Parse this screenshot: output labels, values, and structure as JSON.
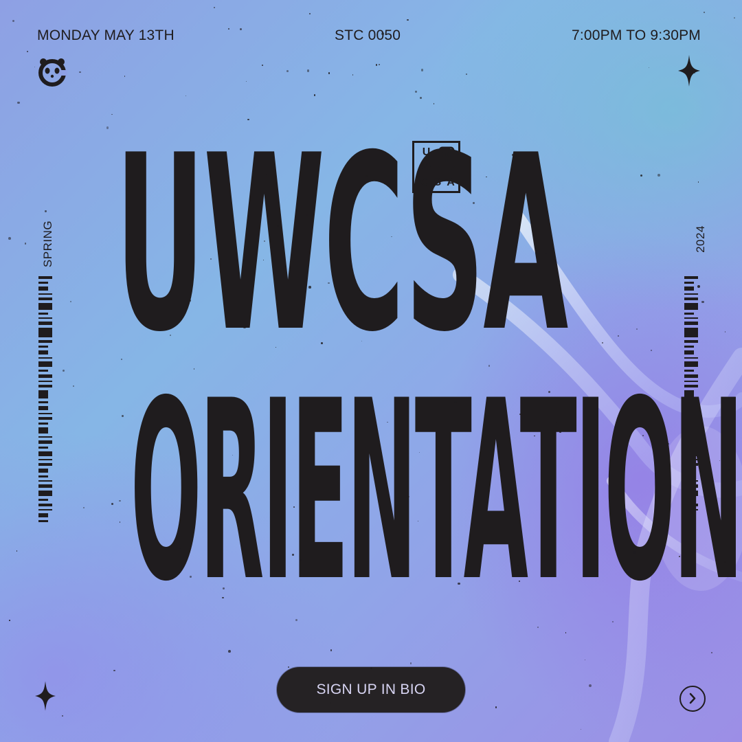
{
  "header": {
    "date": "MONDAY MAY 13TH",
    "room": "STC 0050",
    "time": "7:00PM TO 9:30PM"
  },
  "side": {
    "left_label": "SPRING",
    "right_label": "2024"
  },
  "headline": {
    "line1": "UWCSA",
    "line2": "ORIENTATION"
  },
  "logo_badge": {
    "letter_u": "U",
    "letter_w": "W",
    "letters_csa": "CSA"
  },
  "cta": {
    "label": "SIGN UP IN BIO"
  },
  "icons": {
    "logo": "panda-logo-icon",
    "sparkle": "sparkle-icon",
    "next": "chevron-right-circle-icon"
  },
  "colors": {
    "ink": "#1f1c1e",
    "button_bg": "#252224",
    "button_text": "#d7d4f2"
  }
}
